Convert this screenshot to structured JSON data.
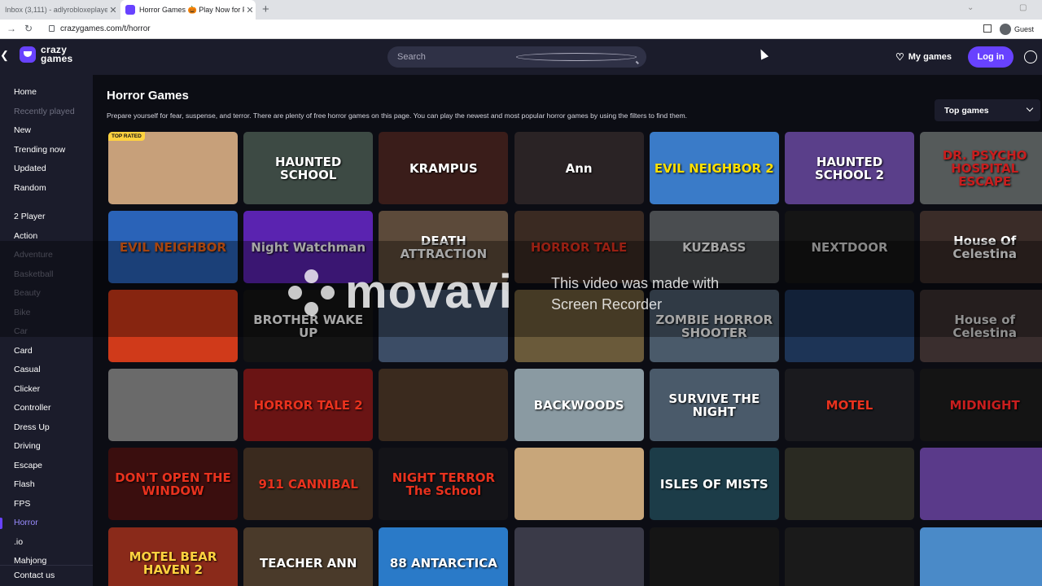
{
  "browser": {
    "tabs": [
      {
        "title": "Inbox (3,111) - adlyrobloxeplaye...",
        "active": false
      },
      {
        "title": "Horror Games 🎃 Play Now for F...",
        "active": true
      }
    ],
    "new_tab": "+",
    "url": "crazygames.com/t/horror",
    "profile": "Guest"
  },
  "header": {
    "logo_line1": "crazy",
    "logo_line2": "games",
    "search_placeholder": "Search",
    "my_games": "My games",
    "login": "Log in"
  },
  "sidebar": {
    "items": [
      {
        "label": "Home",
        "state": "normal"
      },
      {
        "label": "Recently played",
        "state": "dim"
      },
      {
        "label": "New",
        "state": "normal"
      },
      {
        "label": "Trending now",
        "state": "normal"
      },
      {
        "label": "Updated",
        "state": "normal"
      },
      {
        "label": "Random",
        "state": "normal"
      },
      {
        "label": "2 Player",
        "state": "normal"
      },
      {
        "label": "Action",
        "state": "normal"
      },
      {
        "label": "Adventure",
        "state": "dim"
      },
      {
        "label": "Basketball",
        "state": "dim"
      },
      {
        "label": "Beauty",
        "state": "dim"
      },
      {
        "label": "Bike",
        "state": "dim"
      },
      {
        "label": "Car",
        "state": "dim"
      },
      {
        "label": "Card",
        "state": "normal"
      },
      {
        "label": "Casual",
        "state": "normal"
      },
      {
        "label": "Clicker",
        "state": "normal"
      },
      {
        "label": "Controller",
        "state": "normal"
      },
      {
        "label": "Dress Up",
        "state": "normal"
      },
      {
        "label": "Driving",
        "state": "normal"
      },
      {
        "label": "Escape",
        "state": "normal"
      },
      {
        "label": "Flash",
        "state": "normal"
      },
      {
        "label": "FPS",
        "state": "normal"
      },
      {
        "label": "Horror",
        "state": "active"
      },
      {
        "label": ".io",
        "state": "normal"
      },
      {
        "label": "Mahjong",
        "state": "normal"
      }
    ],
    "contact": "Contact us"
  },
  "main": {
    "title": "Horror Games",
    "description": "Prepare yourself for fear, suspense, and terror. There are plenty of free horror games on this page. You can play the newest and most popular horror games by using the filters to find them.",
    "sort_label": "Top games",
    "badge": "TOP RATED",
    "games": [
      [
        "",
        "HAUNTED SCHOOL",
        "KRAMPUS",
        "Ann",
        "EVIL NEIGHBOR 2",
        "HAUNTED SCHOOL 2",
        "DR. PSYCHO HOSPITAL ESCAPE"
      ],
      [
        "EVIL NEIGHBOR",
        "Night Watchman",
        "DEATH ATTRACTION",
        "HORROR TALE",
        "KUZBASS",
        "NEXTDOOR",
        "House Of Celestina"
      ],
      [
        "",
        "BROTHER WAKE UP",
        "",
        "",
        "ZOMBIE HORROR SHOOTER",
        "",
        "House of Celestina"
      ],
      [
        "",
        "HORROR TALE 2",
        "",
        "BACKWOODS",
        "SURVIVE THE NIGHT",
        "MOTEL",
        "MIDNIGHT"
      ],
      [
        "DON'T OPEN THE WINDOW",
        "911 CANNIBAL",
        "NIGHT TERROR The School",
        "",
        "ISLES OF MISTS",
        "",
        ""
      ],
      [
        "MOTEL BEAR HAVEN 2",
        "TEACHER ANN",
        "88 ANTARCTICA",
        "",
        "",
        "",
        ""
      ]
    ],
    "colors": [
      [
        "#c7a07a",
        "#3d4a44",
        "#3a1d1a",
        "#2a2325",
        "#3a7bc8",
        "#5a3f8a",
        "#555a5a"
      ],
      [
        "#2a63b8",
        "#5a23b0",
        "#5c4a3a",
        "#3a2a22",
        "#4a4d50",
        "#151515",
        "#3a2c28"
      ],
      [
        "#d03a1a",
        "#141414",
        "#3c4d66",
        "#6a5a3a",
        "#4a5a6a",
        "#1d3456",
        "#3a2e2e"
      ],
      [
        "#6a6a6a",
        "#6a1414",
        "#3a2a1e",
        "#8a9aa2",
        "#4a5a6a",
        "#1a1a1e",
        "#141414"
      ],
      [
        "#3a0e0e",
        "#3a2a1e",
        "#141418",
        "#c8a67a",
        "#1c3c48",
        "#2a2a22",
        "#5a3a8a"
      ],
      [
        "#8a2a1a",
        "#4a3a2a",
        "#2a7ac8",
        "#3a3a48",
        "#151515",
        "#1a1a1a",
        "#4a8ac8"
      ]
    ],
    "label_colors": [
      [
        "#ffffff",
        "#ffffff",
        "#ffffff",
        "#ffffff",
        "#ffe000",
        "#ffffff",
        "#c81e1e"
      ],
      [
        "#ff6a1a",
        "#ffffff",
        "#ffffff",
        "#e8321e",
        "#ffffff",
        "#cfcfcf",
        "#ffffff"
      ],
      [
        "#ffffff",
        "#ffffff",
        "#ffffff",
        "#ffffff",
        "#ffffff",
        "#ffffff",
        "#dddddd"
      ],
      [
        "#ffffff",
        "#e8321e",
        "#ffffff",
        "#ffffff",
        "#ffffff",
        "#e8321e",
        "#c81e1e"
      ],
      [
        "#e8321e",
        "#e8321e",
        "#e8321e",
        "#ffffff",
        "#ffffff",
        "#ffffff",
        "#ffffff"
      ],
      [
        "#ffd23f",
        "#ffffff",
        "#ffffff",
        "#ffffff",
        "#ffffff",
        "#ffffff",
        "#ffffff"
      ]
    ]
  },
  "watermark": {
    "brand": "movavi",
    "line1": "This video was made with",
    "line2": "Screen Recorder"
  }
}
